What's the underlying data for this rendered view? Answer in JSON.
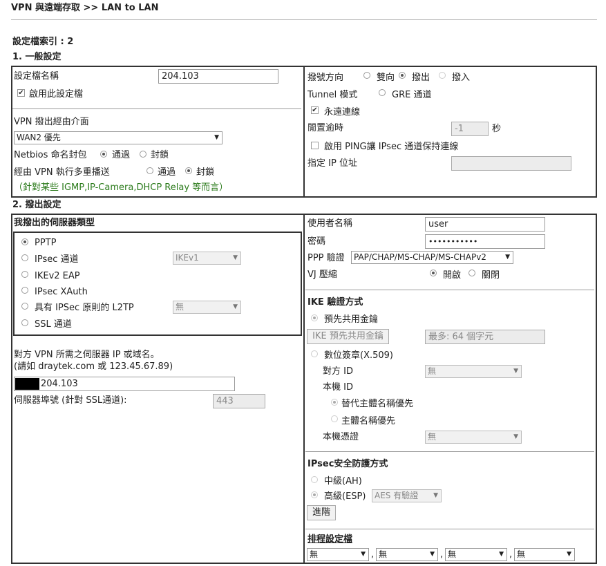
{
  "page": {
    "breadcrumb": "VPN 與遠端存取 >> LAN to LAN",
    "profile_index_label": "設定檔索引 : 2",
    "section1_title": "1. 一般設定",
    "section2_title": "2. 撥出設定"
  },
  "general": {
    "profile_name_label": "設定檔名稱",
    "profile_name_value": "204.103",
    "enable_profile_label": "啟用此設定檔",
    "enable_profile_checked": true,
    "dialout_iface_label": "VPN 撥出經由介面",
    "dialout_iface_value": "WAN2 優先",
    "netbios_label": "Netbios 命名封包",
    "netbios_pass": "通過",
    "netbios_block": "封鎖",
    "netbios_selected": "通過",
    "multicast_label": "經由 VPN 執行多重播送",
    "multicast_pass": "通過",
    "multicast_block": "封鎖",
    "multicast_selected": "封鎖",
    "multicast_note": "（針對某些 IGMP,IP-Camera,DHCP Relay 等而言）",
    "dial_direction_label": "撥號方向",
    "dir_both": "雙向",
    "dir_out": "撥出",
    "dir_in": "撥入",
    "dir_selected": "撥出",
    "tunnel_mode_label": "Tunnel 模式",
    "tunnel_gre": "GRE 通道",
    "always_on_label": "永遠連線",
    "always_on_checked": true,
    "idle_timeout_label": "閒置逾時",
    "idle_timeout_value": "-1",
    "idle_timeout_unit": "秒",
    "ping_keepalive_label": "啟用 PING讓 IPsec 通道保持連線",
    "ping_ip_label": "指定 IP 位址",
    "ping_ip_value": ""
  },
  "dialout": {
    "server_type_title": "我撥出的伺服器類型",
    "types": [
      "PPTP",
      "IPsec 通道",
      "IKEv2 EAP",
      "IPsec XAuth",
      "具有 IPSec 原則的 L2TP",
      "SSL 通道"
    ],
    "type_selected": "PPTP",
    "ipsec_ike_value": "IKEv1",
    "l2tp_policy_value": "無",
    "server_ip_label_1": "對方 VPN 所需之伺服器 IP 或域名。",
    "server_ip_label_2": "(請如 draytek.com 或 123.45.67.89)",
    "server_ip_value": "204.103",
    "server_port_label": "伺服器埠號 (針對 SSL通道):",
    "server_port_value": "443",
    "username_label": "使用者名稱",
    "username_value": "user",
    "password_label": "密碼",
    "password_value": "•••••••••••",
    "ppp_auth_label": "PPP 驗證",
    "ppp_auth_value": "PAP/CHAP/MS-CHAP/MS-CHAPv2",
    "vj_label": "VJ 壓縮",
    "vj_on": "開啟",
    "vj_off": "關閉",
    "vj_selected": "開啟",
    "ike_title": "IKE 驗證方式",
    "psk_label": "預先共用金鑰",
    "ike_psk_button": "IKE 預先共用金鑰",
    "ike_psk_placeholder": "最多: 64 個字元",
    "cert_label": "數位簽章(X.509)",
    "peer_id_label": "對方 ID",
    "peer_id_value": "無",
    "local_id_label": "本機 ID",
    "alt_subject_label": "替代主體名稱優先",
    "subject_label": "主體名稱優先",
    "local_cert_label": "本機憑證",
    "local_cert_value": "無",
    "ipsec_title": "IPsec安全防護方式",
    "ah_label": "中級(AH)",
    "esp_label": "高級(ESP)",
    "esp_value": "AES 有驗證",
    "advanced_button": "進階",
    "schedule_title": "排程設定檔",
    "schedules": [
      "無",
      "無",
      "無",
      "無"
    ],
    "schedule_sep": ","
  }
}
